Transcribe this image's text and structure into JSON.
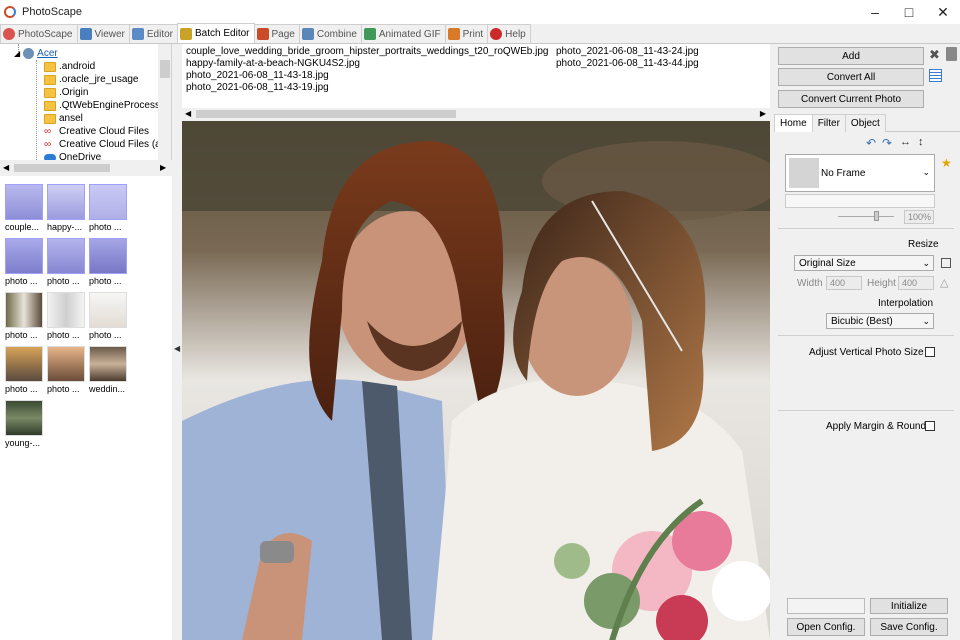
{
  "window": {
    "title": "PhotoScape"
  },
  "tabs": [
    {
      "label": "PhotoScape",
      "icon": "photoscape-icon",
      "color": "#d9534f"
    },
    {
      "label": "Viewer",
      "icon": "viewer-icon",
      "color": "#4a7fbf"
    },
    {
      "label": "Editor",
      "icon": "editor-icon",
      "color": "#5b8ac6"
    },
    {
      "label": "Batch Editor",
      "icon": "batch-editor-icon",
      "color": "#c9a227"
    },
    {
      "label": "Page",
      "icon": "page-icon",
      "color": "#c94b2a"
    },
    {
      "label": "Combine",
      "icon": "combine-icon",
      "color": "#5a87b8"
    },
    {
      "label": "Animated GIF",
      "icon": "animated-gif-icon",
      "color": "#3f9a5a"
    },
    {
      "label": "Print",
      "icon": "print-icon",
      "color": "#d97a2b"
    },
    {
      "label": "Help",
      "icon": "help-icon",
      "color": "#cc2a2a"
    }
  ],
  "active_tab": "Batch Editor",
  "tree": {
    "root": "Acer",
    "items": [
      ".android",
      ".oracle_jre_usage",
      ".Origin",
      ".QtWebEngineProcess",
      "ansel",
      "Creative Cloud Files",
      "Creative Cloud Files (a",
      "OneDrive"
    ]
  },
  "thumbnails": [
    "couple...",
    "happy-...",
    "photo ...",
    "photo ...",
    "photo ...",
    "photo ...",
    "photo ...",
    "photo ...",
    "photo ...",
    "photo ...",
    "photo ...",
    "weddin...",
    "young-..."
  ],
  "files": {
    "col1": [
      "couple_love_wedding_bride_groom_hipster_portraits_weddings_t20_roQWEb.jpg",
      "happy-family-at-a-beach-NGKU4S2.jpg",
      "photo_2021-06-08_11-43-18.jpg",
      "photo_2021-06-08_11-43-19.jpg"
    ],
    "col2": [
      "photo_2021-06-08_11-43-24.jpg",
      "photo_2021-06-08_11-43-44.jpg"
    ]
  },
  "right": {
    "add": "Add",
    "convert_all": "Convert All",
    "convert_current": "Convert Current Photo",
    "tabs": [
      "Home",
      "Filter",
      "Object"
    ],
    "frame": "No Frame",
    "zoom": "100%",
    "resize_label": "Resize",
    "resize_value": "Original Size",
    "width_label": "Width",
    "width_value": "400",
    "height_label": "Height",
    "height_value": "400",
    "interp_label": "Interpolation",
    "interp_value": "Bicubic (Best)",
    "adjust_vertical": "Adjust Vertical Photo Size",
    "apply_margin": "Apply Margin & Round",
    "initialize": "Initialize",
    "open_config": "Open Config.",
    "save_config": "Save Config."
  }
}
